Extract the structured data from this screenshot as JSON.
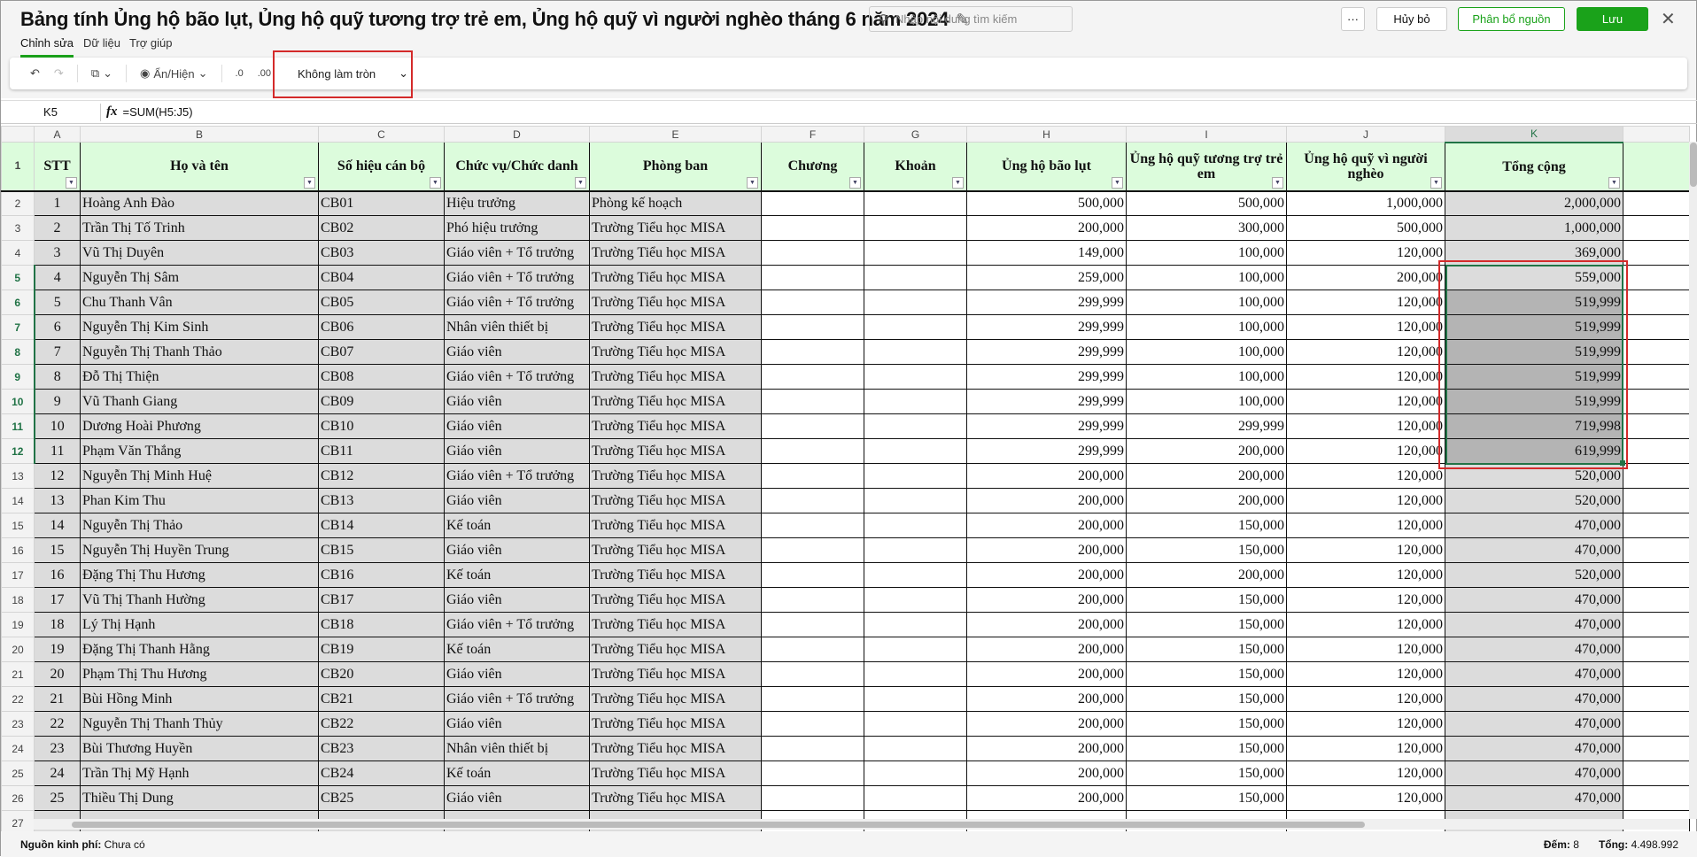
{
  "title": "Bảng tính Ủng hộ bão lụt, Ủng hộ quỹ tương trợ trẻ em, Ủng hộ quỹ vì người nghèo tháng 6 năm 2024",
  "tabs": [
    "Chỉnh sửa",
    "Dữ liệu",
    "Trợ giúp"
  ],
  "search_placeholder": "Nhập nội dung tìm kiếm",
  "buttons": {
    "more": "···",
    "cancel": "Hủy bỏ",
    "allocate": "Phân bổ nguồn",
    "save": "Lưu",
    "close": "✕"
  },
  "toolbar": {
    "show_hide": "Ẩn/Hiện",
    "rounding": "Không làm tròn"
  },
  "formula": {
    "cell": "K5",
    "fx": "fx",
    "value": "=SUM(H5:J5)"
  },
  "colors": {
    "accent": "#1aa21a",
    "header_fill": "#dcfcdc",
    "selection": "#217346",
    "highlight": "#d42a2a"
  },
  "columns": [
    "A",
    "B",
    "C",
    "D",
    "E",
    "F",
    "G",
    "H",
    "I",
    "J",
    "K"
  ],
  "headers": [
    "STT",
    "Họ và tên",
    "Số hiệu cán bộ",
    "Chức vụ/Chức danh",
    "Phòng ban",
    "Chương",
    "Khoản",
    "Ủng hộ bão lụt",
    "Ủng hộ quỹ tương trợ trẻ em",
    "Ủng hộ quỹ vì người nghèo",
    "Tổng cộng"
  ],
  "rows": [
    [
      "1",
      "Hoàng Anh Đào",
      "CB01",
      "Hiệu trưởng",
      "Phòng kế hoạch",
      "",
      "",
      "500,000",
      "500,000",
      "1,000,000",
      "2,000,000"
    ],
    [
      "2",
      "Trần Thị Tố Trinh",
      "CB02",
      "Phó hiệu trưởng",
      "Trường Tiểu học MISA",
      "",
      "",
      "200,000",
      "300,000",
      "500,000",
      "1,000,000"
    ],
    [
      "3",
      "Vũ Thị Duyên",
      "CB03",
      "Giáo viên + Tổ trưởng",
      "Trường Tiểu học MISA",
      "",
      "",
      "149,000",
      "100,000",
      "120,000",
      "369,000"
    ],
    [
      "4",
      "Nguyễn Thị Sâm",
      "CB04",
      "Giáo viên + Tổ trưởng",
      "Trường Tiểu học MISA",
      "",
      "",
      "259,000",
      "100,000",
      "200,000",
      "559,000"
    ],
    [
      "5",
      "Chu Thanh Vân",
      "CB05",
      "Giáo viên + Tổ trưởng",
      "Trường Tiểu học MISA",
      "",
      "",
      "299,999",
      "100,000",
      "120,000",
      "519,999"
    ],
    [
      "6",
      "Nguyễn Thị Kim Sinh",
      "CB06",
      "Nhân viên thiết bị",
      "Trường Tiểu học MISA",
      "",
      "",
      "299,999",
      "100,000",
      "120,000",
      "519,999"
    ],
    [
      "7",
      "Nguyễn Thị Thanh Thảo",
      "CB07",
      "Giáo viên",
      "Trường Tiểu học MISA",
      "",
      "",
      "299,999",
      "100,000",
      "120,000",
      "519,999"
    ],
    [
      "8",
      "Đỗ Thị Thiện",
      "CB08",
      "Giáo viên + Tổ trưởng",
      "Trường Tiểu học MISA",
      "",
      "",
      "299,999",
      "100,000",
      "120,000",
      "519,999"
    ],
    [
      "9",
      "Vũ Thanh Giang",
      "CB09",
      "Giáo viên",
      "Trường Tiểu học MISA",
      "",
      "",
      "299,999",
      "100,000",
      "120,000",
      "519,999"
    ],
    [
      "10",
      "Dương Hoài Phương",
      "CB10",
      "Giáo viên",
      "Trường Tiểu học MISA",
      "",
      "",
      "299,999",
      "299,999",
      "120,000",
      "719,998"
    ],
    [
      "11",
      "Phạm Văn Thắng",
      "CB11",
      "Giáo viên",
      "Trường Tiểu học MISA",
      "",
      "",
      "299,999",
      "200,000",
      "120,000",
      "619,999"
    ],
    [
      "12",
      "Nguyễn Thị Minh Huệ",
      "CB12",
      "Giáo viên + Tổ trưởng",
      "Trường Tiểu học MISA",
      "",
      "",
      "200,000",
      "200,000",
      "120,000",
      "520,000"
    ],
    [
      "13",
      "Phan Kim Thu",
      "CB13",
      "Giáo viên",
      "Trường Tiểu học MISA",
      "",
      "",
      "200,000",
      "200,000",
      "120,000",
      "520,000"
    ],
    [
      "14",
      "Nguyễn Thị Thảo",
      "CB14",
      "Kế toán",
      "Trường Tiểu học MISA",
      "",
      "",
      "200,000",
      "150,000",
      "120,000",
      "470,000"
    ],
    [
      "15",
      "Nguyễn Thị Huyền Trung",
      "CB15",
      "Giáo viên",
      "Trường Tiểu học MISA",
      "",
      "",
      "200,000",
      "150,000",
      "120,000",
      "470,000"
    ],
    [
      "16",
      "Đặng Thị Thu Hương",
      "CB16",
      "Kế toán",
      "Trường Tiểu học MISA",
      "",
      "",
      "200,000",
      "200,000",
      "120,000",
      "520,000"
    ],
    [
      "17",
      "Vũ Thị Thanh Hường",
      "CB17",
      "Giáo viên",
      "Trường Tiểu học MISA",
      "",
      "",
      "200,000",
      "150,000",
      "120,000",
      "470,000"
    ],
    [
      "18",
      "Lý Thị Hạnh",
      "CB18",
      "Giáo viên + Tổ trưởng",
      "Trường Tiểu học MISA",
      "",
      "",
      "200,000",
      "150,000",
      "120,000",
      "470,000"
    ],
    [
      "19",
      "Đặng Thị Thanh Hằng",
      "CB19",
      "Kế toán",
      "Trường Tiểu học MISA",
      "",
      "",
      "200,000",
      "150,000",
      "120,000",
      "470,000"
    ],
    [
      "20",
      "Phạm Thị Thu Hương",
      "CB20",
      "Giáo viên",
      "Trường Tiểu học MISA",
      "",
      "",
      "200,000",
      "150,000",
      "120,000",
      "470,000"
    ],
    [
      "21",
      "Bùi Hồng Minh",
      "CB21",
      "Giáo viên + Tổ trưởng",
      "Trường Tiểu học MISA",
      "",
      "",
      "200,000",
      "150,000",
      "120,000",
      "470,000"
    ],
    [
      "22",
      "Nguyễn Thị Thanh Thủy",
      "CB22",
      "Giáo viên",
      "Trường Tiểu học MISA",
      "",
      "",
      "200,000",
      "150,000",
      "120,000",
      "470,000"
    ],
    [
      "23",
      "Bùi Thương Huyền",
      "CB23",
      "Nhân viên thiết bị",
      "Trường Tiểu học MISA",
      "",
      "",
      "200,000",
      "150,000",
      "120,000",
      "470,000"
    ],
    [
      "24",
      "Trần Thị Mỹ Hạnh",
      "CB24",
      "Kế toán",
      "Trường Tiểu học MISA",
      "",
      "",
      "200,000",
      "150,000",
      "120,000",
      "470,000"
    ],
    [
      "25",
      "Thiều Thị Dung",
      "CB25",
      "Giáo viên",
      "Trường Tiểu học MISA",
      "",
      "",
      "200,000",
      "150,000",
      "120,000",
      "470,000"
    ]
  ],
  "selected_rows": [
    5,
    6,
    7,
    8,
    9,
    10,
    11,
    12
  ],
  "status": {
    "source_label": "Nguồn kinh phí:",
    "source_value": "Chưa có",
    "count_label": "Đếm:",
    "count_value": "8",
    "sum_label": "Tổng:",
    "sum_value": "4.498.992"
  }
}
